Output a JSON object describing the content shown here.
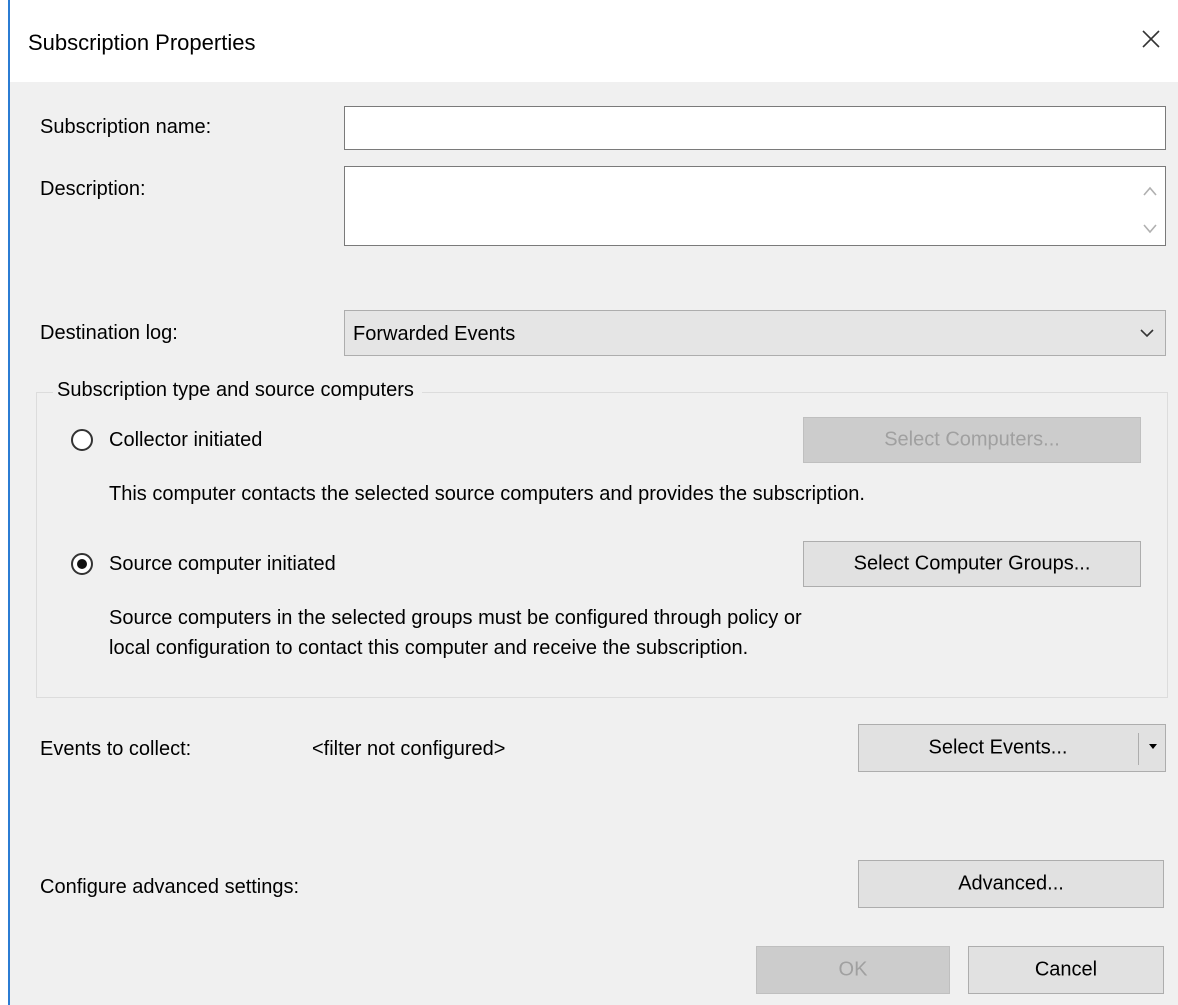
{
  "window": {
    "title": "Subscription Properties"
  },
  "form": {
    "name_label": "Subscription name:",
    "name_value": "",
    "description_label": "Description:",
    "description_value": "",
    "destination_label": "Destination log:",
    "destination_value": "Forwarded Events"
  },
  "subscription_type": {
    "legend": "Subscription type and source computers",
    "collector": {
      "label": "Collector initiated",
      "selected": false,
      "button": "Select Computers...",
      "button_enabled": false,
      "description": "This computer contacts the selected source computers and provides the subscription."
    },
    "source": {
      "label": "Source computer initiated",
      "selected": true,
      "button": "Select Computer Groups...",
      "button_enabled": true,
      "description_line1": "Source computers in the selected groups must be configured through policy or",
      "description_line2": "local configuration to contact this computer and receive the subscription."
    }
  },
  "events": {
    "label": "Events to collect:",
    "value": "<filter not configured>",
    "button": "Select Events..."
  },
  "advanced": {
    "label": "Configure advanced settings:",
    "button": "Advanced..."
  },
  "footer": {
    "ok": "OK",
    "ok_enabled": false,
    "cancel": "Cancel"
  },
  "colors": {
    "accent": "#2b7cd3",
    "client_bg": "#f0f0f0",
    "button_bg": "#e1e1e1",
    "disabled_button_bg": "#cccccc",
    "disabled_text": "#a0a0a0"
  },
  "icons": {
    "close": "close-icon",
    "dropdown": "chevron-down-icon",
    "scroll_up": "scroll-up-icon",
    "scroll_down": "scroll-down-icon",
    "split": "caret-down-icon"
  }
}
